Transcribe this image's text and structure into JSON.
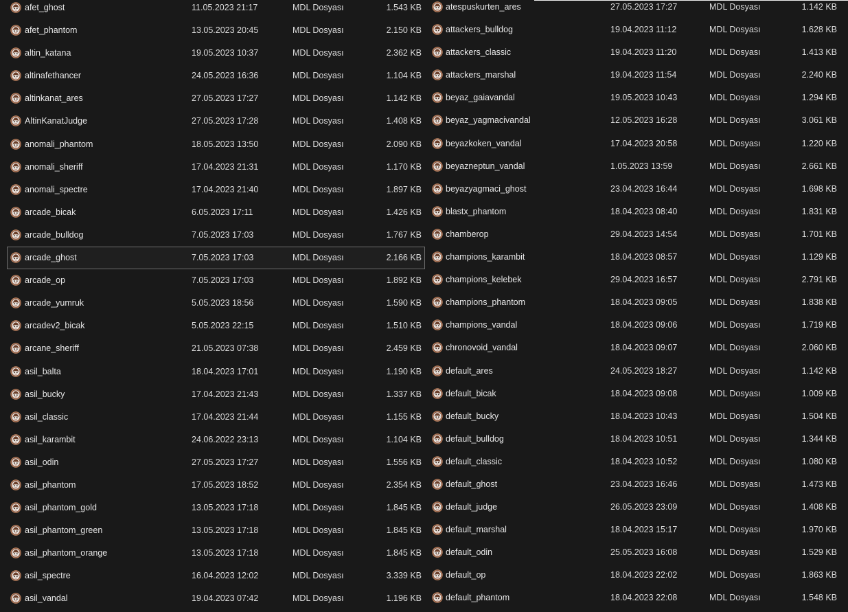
{
  "type_label": "MDL Dosyası",
  "selected_file": "arcade_ghost",
  "left_files": [
    {
      "name": "afet_ghost",
      "date": "11.05.2023 21:17",
      "size": "1.543 KB"
    },
    {
      "name": "afet_phantom",
      "date": "13.05.2023 20:45",
      "size": "2.150 KB"
    },
    {
      "name": "altin_katana",
      "date": "19.05.2023 10:37",
      "size": "2.362 KB"
    },
    {
      "name": "altinafethancer",
      "date": "24.05.2023 16:36",
      "size": "1.104 KB"
    },
    {
      "name": "altinkanat_ares",
      "date": "27.05.2023 17:27",
      "size": "1.142 KB"
    },
    {
      "name": "AltinKanatJudge",
      "date": "27.05.2023 17:28",
      "size": "1.408 KB"
    },
    {
      "name": "anomali_phantom",
      "date": "18.05.2023 13:50",
      "size": "2.090 KB"
    },
    {
      "name": "anomali_sheriff",
      "date": "17.04.2023 21:31",
      "size": "1.170 KB"
    },
    {
      "name": "anomali_spectre",
      "date": "17.04.2023 21:40",
      "size": "1.897 KB"
    },
    {
      "name": "arcade_bicak",
      "date": "6.05.2023 17:11",
      "size": "1.426 KB"
    },
    {
      "name": "arcade_bulldog",
      "date": "7.05.2023 17:03",
      "size": "1.767 KB"
    },
    {
      "name": "arcade_ghost",
      "date": "7.05.2023 17:03",
      "size": "2.166 KB"
    },
    {
      "name": "arcade_op",
      "date": "7.05.2023 17:03",
      "size": "1.892 KB"
    },
    {
      "name": "arcade_yumruk",
      "date": "5.05.2023 18:56",
      "size": "1.590 KB"
    },
    {
      "name": "arcadev2_bicak",
      "date": "5.05.2023 22:15",
      "size": "1.510 KB"
    },
    {
      "name": "arcane_sheriff",
      "date": "21.05.2023 07:38",
      "size": "2.459 KB"
    },
    {
      "name": "asil_balta",
      "date": "18.04.2023 17:01",
      "size": "1.190 KB"
    },
    {
      "name": "asil_bucky",
      "date": "17.04.2023 21:43",
      "size": "1.337 KB"
    },
    {
      "name": "asil_classic",
      "date": "17.04.2023 21:44",
      "size": "1.155 KB"
    },
    {
      "name": "asil_karambit",
      "date": "24.06.2022 23:13",
      "size": "1.104 KB"
    },
    {
      "name": "asil_odin",
      "date": "27.05.2023 17:27",
      "size": "1.556 KB"
    },
    {
      "name": "asil_phantom",
      "date": "17.05.2023 18:52",
      "size": "2.354 KB"
    },
    {
      "name": "asil_phantom_gold",
      "date": "13.05.2023 17:18",
      "size": "1.845 KB"
    },
    {
      "name": "asil_phantom_green",
      "date": "13.05.2023 17:18",
      "size": "1.845 KB"
    },
    {
      "name": "asil_phantom_orange",
      "date": "13.05.2023 17:18",
      "size": "1.845 KB"
    },
    {
      "name": "asil_spectre",
      "date": "16.04.2023 12:02",
      "size": "3.339 KB"
    },
    {
      "name": "asil_vandal",
      "date": "19.04.2023 07:42",
      "size": "1.196 KB"
    }
  ],
  "right_files": [
    {
      "name": "atespuskurten_ares",
      "date": "27.05.2023 17:27",
      "size": "1.142 KB"
    },
    {
      "name": "attackers_bulldog",
      "date": "19.04.2023 11:12",
      "size": "1.628 KB"
    },
    {
      "name": "attackers_classic",
      "date": "19.04.2023 11:20",
      "size": "1.413 KB"
    },
    {
      "name": "attackers_marshal",
      "date": "19.04.2023 11:54",
      "size": "2.240 KB"
    },
    {
      "name": "beyaz_gaiavandal",
      "date": "19.05.2023 10:43",
      "size": "1.294 KB"
    },
    {
      "name": "beyaz_yagmacivandal",
      "date": "12.05.2023 16:28",
      "size": "3.061 KB"
    },
    {
      "name": "beyazkoken_vandal",
      "date": "17.04.2023 20:58",
      "size": "1.220 KB"
    },
    {
      "name": "beyazneptun_vandal",
      "date": "1.05.2023 13:59",
      "size": "2.661 KB"
    },
    {
      "name": "beyazyagmaci_ghost",
      "date": "23.04.2023 16:44",
      "size": "1.698 KB"
    },
    {
      "name": "blastx_phantom",
      "date": "18.04.2023 08:40",
      "size": "1.831 KB"
    },
    {
      "name": "chamberop",
      "date": "29.04.2023 14:54",
      "size": "1.701 KB"
    },
    {
      "name": "champions_karambit",
      "date": "18.04.2023 08:57",
      "size": "1.129 KB"
    },
    {
      "name": "champions_kelebek",
      "date": "29.04.2023 16:57",
      "size": "2.791 KB"
    },
    {
      "name": "champions_phantom",
      "date": "18.04.2023 09:05",
      "size": "1.838 KB"
    },
    {
      "name": "champions_vandal",
      "date": "18.04.2023 09:06",
      "size": "1.719 KB"
    },
    {
      "name": "chronovoid_vandal",
      "date": "18.04.2023 09:07",
      "size": "2.060 KB"
    },
    {
      "name": "default_ares",
      "date": "24.05.2023 18:27",
      "size": "1.142 KB"
    },
    {
      "name": "default_bicak",
      "date": "18.04.2023 09:08",
      "size": "1.009 KB"
    },
    {
      "name": "default_bucky",
      "date": "18.04.2023 10:43",
      "size": "1.504 KB"
    },
    {
      "name": "default_bulldog",
      "date": "18.04.2023 10:51",
      "size": "1.344 KB"
    },
    {
      "name": "default_classic",
      "date": "18.04.2023 10:52",
      "size": "1.080 KB"
    },
    {
      "name": "default_ghost",
      "date": "23.04.2023 16:46",
      "size": "1.473 KB"
    },
    {
      "name": "default_judge",
      "date": "26.05.2023 23:09",
      "size": "1.408 KB"
    },
    {
      "name": "default_marshal",
      "date": "18.04.2023 15:17",
      "size": "1.970 KB"
    },
    {
      "name": "default_odin",
      "date": "25.05.2023 16:08",
      "size": "1.529 KB"
    },
    {
      "name": "default_op",
      "date": "18.04.2023 22:02",
      "size": "1.863 KB"
    },
    {
      "name": "default_phantom",
      "date": "18.04.2023 22:08",
      "size": "1.548 KB"
    }
  ],
  "icon": "mdl-file-icon",
  "colors": {
    "background": "#191919",
    "text": "#e6e6e6",
    "selection_border": "#6f6f6f"
  }
}
